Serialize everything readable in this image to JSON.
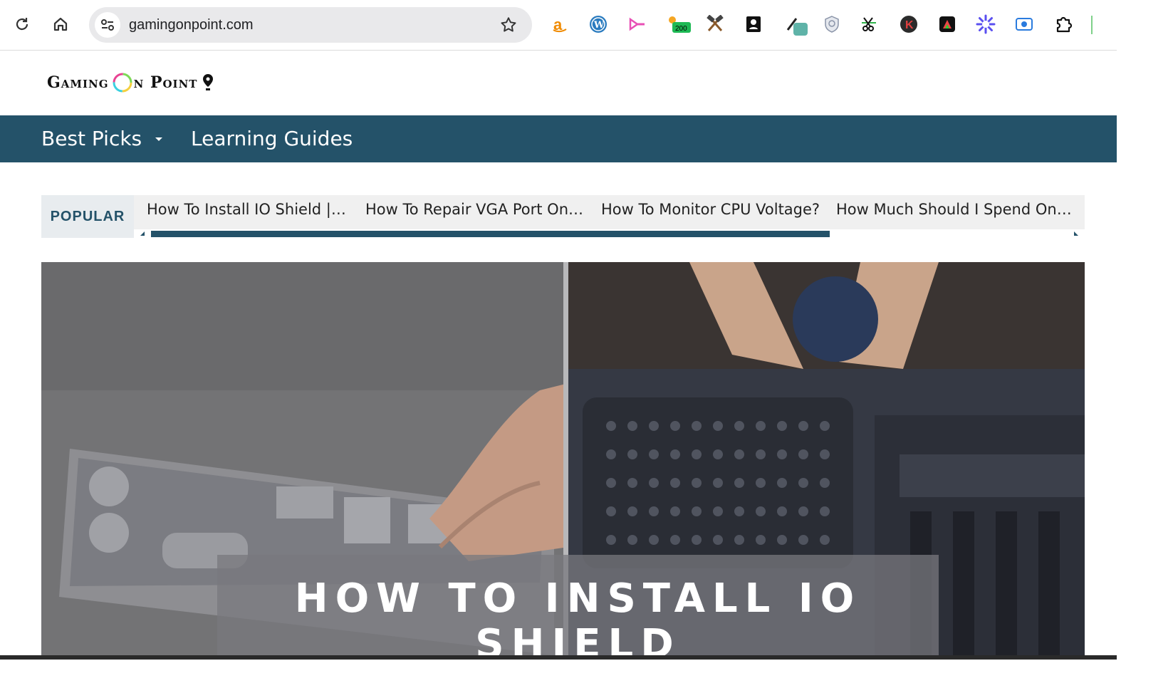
{
  "browser": {
    "url": "gamingonpoint.com",
    "extensions": [
      "amazon-icon",
      "wordpress-icon",
      "arrow-extension-icon",
      "counter-extension-icon",
      "tools-icon",
      "contacts-icon",
      "eyedropper-icon",
      "shield-icon",
      "scissors-icon",
      "k-extension-icon",
      "color-extension-icon",
      "gear-extension-icon",
      "record-icon",
      "puzzle-icon"
    ],
    "badge_count": "200"
  },
  "site": {
    "logo_part1": "Gaming",
    "logo_part2": "n Point"
  },
  "nav": {
    "best_picks": "Best Picks",
    "learning_guides": "Learning Guides"
  },
  "popular": {
    "label": "POPULAR",
    "items": [
      "How To Install IO Shield |…",
      "How To Repair VGA Port On…",
      "How To Monitor CPU Voltage?",
      "How Much Should I Spend On…"
    ]
  },
  "hero": {
    "title": "HOW TO INSTALL IO SHIELD"
  },
  "colors": {
    "nav_bg": "#245269",
    "accent": "#245269"
  }
}
